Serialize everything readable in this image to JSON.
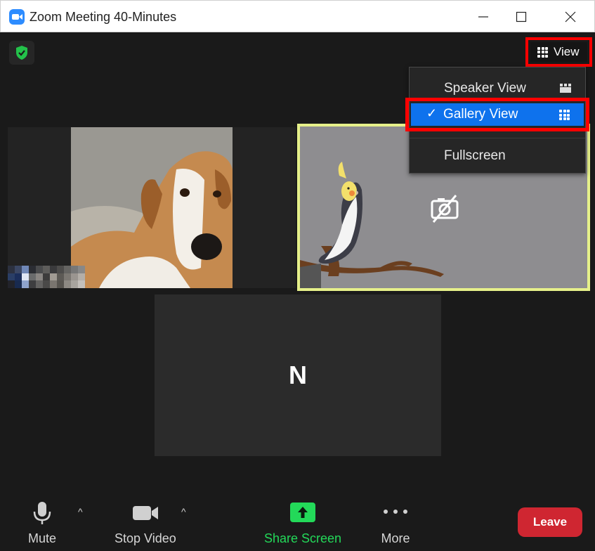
{
  "window": {
    "title": "Zoom Meeting 40-Minutes",
    "minimize_label": "—",
    "maximize_label": "☐",
    "close_label": "✕"
  },
  "view_button": {
    "label": "View"
  },
  "view_menu": {
    "items": [
      {
        "label": "Speaker View",
        "icon": "speaker-view-icon",
        "selected": false
      },
      {
        "label": "Gallery View",
        "icon": "gallery-view-icon",
        "selected": true,
        "check": "✓"
      },
      {
        "label": "Fullscreen",
        "icon": null,
        "selected": false
      }
    ]
  },
  "participants": [
    {
      "kind": "video",
      "subject": "dog",
      "name_pixelated": true
    },
    {
      "kind": "video-off",
      "subject": "bird-avatar",
      "active_speaker": true,
      "name_pixelated": true
    },
    {
      "kind": "initial",
      "initial": "N"
    }
  ],
  "toolbar": {
    "mute_label": "Mute",
    "stop_video_label": "Stop Video",
    "share_label": "Share Screen",
    "more_label": "More",
    "leave_label": "Leave",
    "caret": "^"
  },
  "colors": {
    "accent_blue": "#0e72ed",
    "highlight_red": "#ff0000",
    "share_green": "#23d959",
    "leave_red": "#cf2631",
    "speaker_border": "#e6f08a",
    "shield_green": "#23c14a"
  }
}
